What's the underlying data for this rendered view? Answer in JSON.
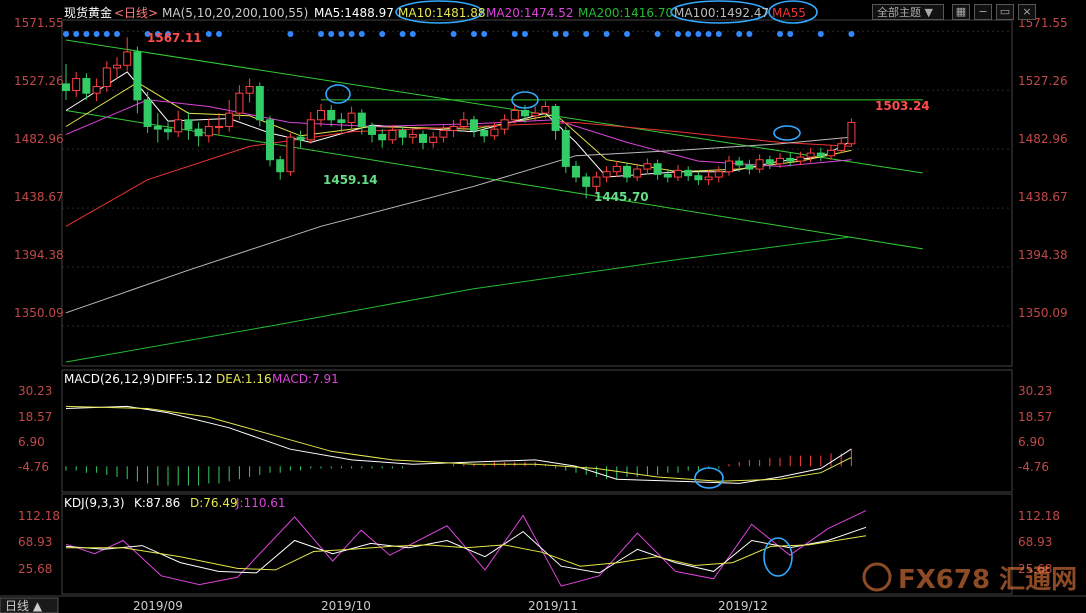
{
  "header": {
    "symbol": "现货黄金",
    "period": "<日线>",
    "ma_params": "MA(5,10,20,200,100,55)",
    "ma5": "MA5:1488.97",
    "ma10": "MA10:1481.88",
    "ma20": "MA20:1474.52",
    "ma200": "MA200:1416.70",
    "ma100": "MA100:1492.47",
    "ma55": "MA55",
    "theme_label": "全部主题",
    "theme_arrow": "▼",
    "icon_grid": "▦",
    "icon_minus": "−",
    "icon_restore": "▭",
    "icon_close": "×"
  },
  "price_axis": {
    "ticks": [
      "1571.55",
      "1527.26",
      "1482.96",
      "1438.67",
      "1394.38",
      "1350.09"
    ]
  },
  "price_annotations": {
    "high": "1567.11",
    "low1": "1459.14",
    "low2": "1445.70",
    "last": "1503.24"
  },
  "macd": {
    "title": "MACD(26,12,9)",
    "diff": "DIFF:5.12",
    "dea": "DEA:1.16",
    "macd": "MACD:7.91",
    "ticks": [
      "30.23",
      "18.57",
      "6.90",
      "-4.76"
    ]
  },
  "kdj": {
    "title": "KDJ(9,3,3)",
    "k": "K:87.86",
    "d": "D:76.49",
    "j": "J:110.61",
    "ticks": [
      "112.18",
      "68.93",
      "25.68"
    ]
  },
  "time_axis": {
    "period_button": "日线 ▲",
    "labels": [
      "2019/09",
      "2019/10",
      "2019/11",
      "2019/12"
    ]
  },
  "watermark": {
    "text": "FX678 汇通网"
  },
  "colors": {
    "up": "#ff4040",
    "down": "#33cc66",
    "ma5": "#ffffff",
    "ma10": "#e6e64d",
    "ma20": "#dd44dd",
    "ma200": "#22bb33",
    "ma100": "#bbbbbb",
    "ma55": "#ee3333",
    "highlight": "#33aaff"
  },
  "chart_data": {
    "type": "candlestick",
    "x_range": [
      "2019-08-28",
      "2019-12-24"
    ],
    "ylim": [
      1320,
      1580
    ],
    "candles": [
      [
        1532,
        1527,
        1547,
        1520
      ],
      [
        1527,
        1536,
        1541,
        1522
      ],
      [
        1536,
        1525,
        1540,
        1520
      ],
      [
        1525,
        1530,
        1536,
        1519
      ],
      [
        1530,
        1544,
        1549,
        1526
      ],
      [
        1544,
        1546,
        1552,
        1536
      ],
      [
        1546,
        1556,
        1567,
        1542
      ],
      [
        1556,
        1520,
        1560,
        1510
      ],
      [
        1520,
        1500,
        1526,
        1495
      ],
      [
        1500,
        1498,
        1510,
        1488
      ],
      [
        1498,
        1496,
        1503,
        1490
      ],
      [
        1496,
        1505,
        1512,
        1492
      ],
      [
        1505,
        1498,
        1511,
        1490
      ],
      [
        1498,
        1493,
        1503,
        1485
      ],
      [
        1493,
        1500,
        1506,
        1488
      ],
      [
        1500,
        1500,
        1510,
        1494
      ],
      [
        1500,
        1510,
        1520,
        1496
      ],
      [
        1510,
        1525,
        1531,
        1505
      ],
      [
        1525,
        1530,
        1536,
        1518
      ],
      [
        1530,
        1505,
        1533,
        1500
      ],
      [
        1505,
        1475,
        1508,
        1470
      ],
      [
        1475,
        1466,
        1478,
        1460
      ],
      [
        1466,
        1492,
        1495,
        1463
      ],
      [
        1492,
        1490,
        1497,
        1484
      ],
      [
        1490,
        1505,
        1511,
        1487
      ],
      [
        1505,
        1512,
        1517,
        1500
      ],
      [
        1512,
        1505,
        1516,
        1500
      ],
      [
        1505,
        1503,
        1510,
        1496
      ],
      [
        1503,
        1510,
        1515,
        1498
      ],
      [
        1510,
        1500,
        1513,
        1494
      ],
      [
        1500,
        1494,
        1503,
        1488
      ],
      [
        1494,
        1490,
        1498,
        1484
      ],
      [
        1490,
        1497,
        1501,
        1487
      ],
      [
        1497,
        1492,
        1500,
        1486
      ],
      [
        1492,
        1494,
        1498,
        1487
      ],
      [
        1494,
        1488,
        1497,
        1483
      ],
      [
        1488,
        1492,
        1496,
        1484
      ],
      [
        1492,
        1497,
        1501,
        1488
      ],
      [
        1497,
        1500,
        1505,
        1492
      ],
      [
        1500,
        1505,
        1511,
        1496
      ],
      [
        1505,
        1497,
        1508,
        1492
      ],
      [
        1497,
        1493,
        1500,
        1488
      ],
      [
        1493,
        1498,
        1503,
        1490
      ],
      [
        1498,
        1505,
        1509,
        1494
      ],
      [
        1505,
        1512,
        1517,
        1502
      ],
      [
        1512,
        1508,
        1516,
        1503
      ],
      [
        1508,
        1510,
        1515,
        1504
      ],
      [
        1510,
        1515,
        1519,
        1506
      ],
      [
        1515,
        1497,
        1517,
        1490
      ],
      [
        1497,
        1470,
        1500,
        1465
      ],
      [
        1470,
        1462,
        1474,
        1458
      ],
      [
        1462,
        1455,
        1465,
        1446
      ],
      [
        1455,
        1462,
        1466,
        1450
      ],
      [
        1462,
        1466,
        1470,
        1458
      ],
      [
        1466,
        1470,
        1474,
        1462
      ],
      [
        1470,
        1462,
        1473,
        1458
      ],
      [
        1462,
        1468,
        1472,
        1459
      ],
      [
        1468,
        1472,
        1476,
        1464
      ],
      [
        1472,
        1464,
        1475,
        1460
      ],
      [
        1464,
        1462,
        1468,
        1458
      ],
      [
        1462,
        1467,
        1471,
        1459
      ],
      [
        1467,
        1463,
        1470,
        1459
      ],
      [
        1463,
        1460,
        1466,
        1456
      ],
      [
        1460,
        1462,
        1467,
        1456
      ],
      [
        1462,
        1466,
        1470,
        1458
      ],
      [
        1466,
        1474,
        1478,
        1463
      ],
      [
        1474,
        1471,
        1477,
        1466
      ],
      [
        1471,
        1468,
        1475,
        1464
      ],
      [
        1468,
        1475,
        1479,
        1465
      ],
      [
        1475,
        1472,
        1478,
        1468
      ],
      [
        1472,
        1476,
        1480,
        1469
      ],
      [
        1476,
        1474,
        1480,
        1470
      ],
      [
        1474,
        1477,
        1481,
        1471
      ],
      [
        1477,
        1480,
        1484,
        1473
      ],
      [
        1480,
        1478,
        1484,
        1474
      ],
      [
        1478,
        1482,
        1486,
        1475
      ],
      [
        1482,
        1487,
        1492,
        1480
      ],
      [
        1487,
        1503,
        1506,
        1485
      ]
    ],
    "ma_series": [
      {
        "name": "MA5",
        "color": "#ffffff",
        "points": [
          [
            0,
            1512
          ],
          [
            6,
            1541
          ],
          [
            10,
            1504
          ],
          [
            16,
            1506
          ],
          [
            20,
            1495
          ],
          [
            24,
            1488
          ],
          [
            30,
            1501
          ],
          [
            40,
            1496
          ],
          [
            47,
            1510
          ],
          [
            50,
            1488
          ],
          [
            53,
            1462
          ],
          [
            60,
            1466
          ],
          [
            65,
            1466
          ],
          [
            70,
            1474
          ],
          [
            74,
            1477
          ],
          [
            77,
            1489
          ]
        ]
      },
      {
        "name": "MA10",
        "color": "#e6e64d",
        "points": [
          [
            0,
            1500
          ],
          [
            7,
            1533
          ],
          [
            12,
            1510
          ],
          [
            18,
            1508
          ],
          [
            23,
            1493
          ],
          [
            30,
            1500
          ],
          [
            40,
            1498
          ],
          [
            48,
            1509
          ],
          [
            53,
            1475
          ],
          [
            60,
            1466
          ],
          [
            66,
            1468
          ],
          [
            72,
            1474
          ],
          [
            77,
            1482
          ]
        ]
      },
      {
        "name": "MA20",
        "color": "#dd44dd",
        "points": [
          [
            0,
            1494
          ],
          [
            8,
            1520
          ],
          [
            14,
            1515
          ],
          [
            22,
            1503
          ],
          [
            30,
            1500
          ],
          [
            40,
            1502
          ],
          [
            48,
            1505
          ],
          [
            55,
            1488
          ],
          [
            62,
            1474
          ],
          [
            70,
            1470
          ],
          [
            77,
            1475
          ]
        ]
      },
      {
        "name": "MA55",
        "color": "#ee3333",
        "points": [
          [
            0,
            1425
          ],
          [
            8,
            1460
          ],
          [
            18,
            1485
          ],
          [
            28,
            1496
          ],
          [
            40,
            1500
          ],
          [
            50,
            1503
          ],
          [
            60,
            1496
          ],
          [
            70,
            1488
          ],
          [
            77,
            1485
          ]
        ]
      },
      {
        "name": "MA100",
        "color": "#bbbbbb",
        "points": [
          [
            0,
            1360
          ],
          [
            12,
            1392
          ],
          [
            25,
            1425
          ],
          [
            40,
            1455
          ],
          [
            50,
            1478
          ],
          [
            60,
            1482
          ],
          [
            70,
            1487
          ],
          [
            77,
            1492
          ]
        ]
      },
      {
        "name": "MA200",
        "color": "#22bb33",
        "points": [
          [
            0,
            1323
          ],
          [
            20,
            1350
          ],
          [
            40,
            1378
          ],
          [
            60,
            1400
          ],
          [
            77,
            1417
          ]
        ]
      }
    ],
    "trendlines": [
      {
        "color": "#33cc33",
        "from": [
          0,
          1565
        ],
        "to": [
          84,
          1465
        ]
      },
      {
        "color": "#33cc33",
        "from": [
          0,
          1512
        ],
        "to": [
          84,
          1408
        ]
      },
      {
        "color": "#33cc33",
        "from": [
          25,
          1520
        ],
        "to": [
          84,
          1520
        ]
      }
    ],
    "macd": {
      "ylim": [
        -15,
        35
      ],
      "diff": [
        [
          0,
          24
        ],
        [
          6,
          25
        ],
        [
          10,
          22
        ],
        [
          16,
          15
        ],
        [
          22,
          5
        ],
        [
          28,
          0
        ],
        [
          34,
          -2
        ],
        [
          40,
          -1
        ],
        [
          46,
          0
        ],
        [
          50,
          -3
        ],
        [
          54,
          -9
        ],
        [
          60,
          -10
        ],
        [
          66,
          -11
        ],
        [
          70,
          -8
        ],
        [
          74,
          -4
        ],
        [
          77,
          5.12
        ]
      ],
      "dea": [
        [
          0,
          25
        ],
        [
          8,
          24
        ],
        [
          14,
          20
        ],
        [
          20,
          12
        ],
        [
          26,
          4
        ],
        [
          32,
          0
        ],
        [
          40,
          -2
        ],
        [
          46,
          -2
        ],
        [
          52,
          -4
        ],
        [
          58,
          -8
        ],
        [
          64,
          -10
        ],
        [
          70,
          -9
        ],
        [
          74,
          -6
        ],
        [
          77,
          1.16
        ]
      ],
      "hist": [
        -2,
        -2,
        -3,
        -3,
        -4,
        -5,
        -6,
        -7,
        -8,
        -9,
        -9,
        -9,
        -9,
        -9,
        -8,
        -8,
        -7,
        -6,
        -5,
        -4,
        -3,
        -3,
        -2,
        -2,
        -1,
        -1,
        -1,
        -1,
        -1,
        -1,
        -1,
        -1,
        -1,
        -1,
        0,
        0,
        0,
        0,
        1,
        1,
        1,
        1,
        2,
        2,
        2,
        2,
        2,
        1,
        -1,
        -2,
        -3,
        -4,
        -5,
        -6,
        -6,
        -5,
        -5,
        -4,
        -4,
        -3,
        -3,
        -2,
        -2,
        -1,
        -1,
        1,
        2,
        3,
        3,
        4,
        4,
        5,
        5,
        5,
        5,
        6,
        6,
        7.91
      ]
    },
    "kdj": {
      "ylim": [
        0,
        125
      ],
      "k": [
        [
          0,
          62
        ],
        [
          4,
          58
        ],
        [
          8,
          63
        ],
        [
          12,
          40
        ],
        [
          16,
          28
        ],
        [
          20,
          26
        ],
        [
          24,
          70
        ],
        [
          28,
          52
        ],
        [
          32,
          66
        ],
        [
          36,
          60
        ],
        [
          40,
          70
        ],
        [
          44,
          48
        ],
        [
          48,
          82
        ],
        [
          52,
          35
        ],
        [
          56,
          26
        ],
        [
          60,
          58
        ],
        [
          64,
          40
        ],
        [
          68,
          28
        ],
        [
          72,
          70
        ],
        [
          76,
          60
        ],
        [
          80,
          70
        ],
        [
          84,
          87.86
        ]
      ],
      "d": [
        [
          0,
          60
        ],
        [
          6,
          60
        ],
        [
          12,
          48
        ],
        [
          18,
          32
        ],
        [
          22,
          30
        ],
        [
          26,
          55
        ],
        [
          30,
          58
        ],
        [
          34,
          62
        ],
        [
          38,
          64
        ],
        [
          42,
          60
        ],
        [
          46,
          64
        ],
        [
          50,
          54
        ],
        [
          54,
          35
        ],
        [
          58,
          40
        ],
        [
          62,
          48
        ],
        [
          66,
          36
        ],
        [
          70,
          40
        ],
        [
          74,
          62
        ],
        [
          78,
          64
        ],
        [
          84,
          76.49
        ]
      ],
      "j": [
        [
          0,
          65
        ],
        [
          3,
          52
        ],
        [
          6,
          70
        ],
        [
          10,
          22
        ],
        [
          14,
          10
        ],
        [
          18,
          20
        ],
        [
          24,
          102
        ],
        [
          28,
          42
        ],
        [
          31,
          84
        ],
        [
          34,
          50
        ],
        [
          40,
          90
        ],
        [
          44,
          30
        ],
        [
          48,
          104
        ],
        [
          52,
          8
        ],
        [
          56,
          22
        ],
        [
          60,
          80
        ],
        [
          64,
          28
        ],
        [
          68,
          18
        ],
        [
          72,
          92
        ],
        [
          76,
          50
        ],
        [
          80,
          86
        ],
        [
          84,
          110.61
        ]
      ]
    }
  }
}
